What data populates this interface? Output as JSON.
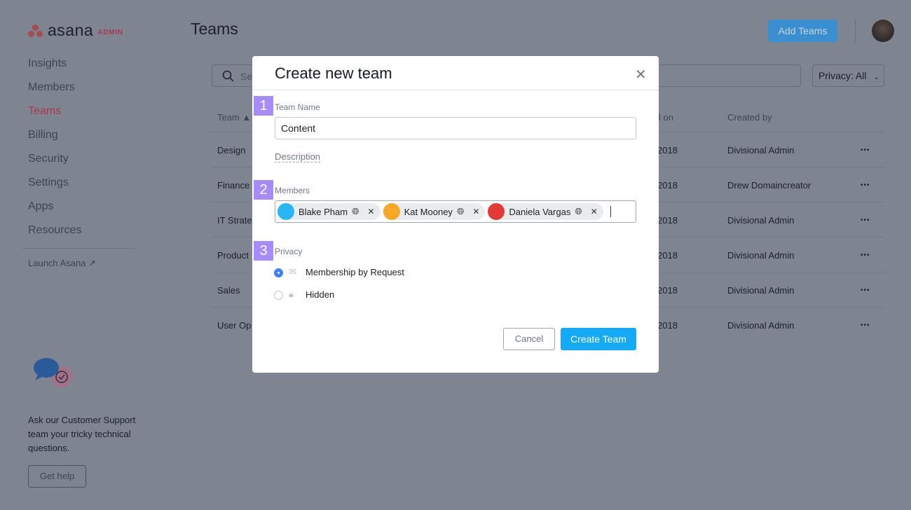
{
  "brand": {
    "name": "asana",
    "badge": "ADMIN"
  },
  "sidebar": {
    "items": [
      {
        "label": "Insights"
      },
      {
        "label": "Members"
      },
      {
        "label": "Teams",
        "active": true
      },
      {
        "label": "Billing"
      },
      {
        "label": "Security"
      },
      {
        "label": "Settings"
      },
      {
        "label": "Apps"
      },
      {
        "label": "Resources"
      }
    ],
    "launch": "Launch Asana ↗",
    "support_text": "Ask our Customer Support team your tricky technical questions.",
    "get_help": "Get help"
  },
  "header": {
    "title": "Teams",
    "add_button": "Add Teams"
  },
  "filters": {
    "search_placeholder": "Se",
    "privacy": "Privacy: All"
  },
  "table": {
    "headers": {
      "team": "Team ▲",
      "created_on": "l on",
      "created_by": "Created by"
    },
    "rows": [
      {
        "team": "Design",
        "date": "2018",
        "by": "Divisional Admin"
      },
      {
        "team": "Finance",
        "date": " 2018",
        "by": "Drew Domaincreator"
      },
      {
        "team": "IT Strate",
        "date": "2018",
        "by": "Divisional Admin"
      },
      {
        "team": "Product",
        "date": "2018",
        "by": "Divisional Admin"
      },
      {
        "team": "Sales",
        "date": "2018",
        "by": "Divisional Admin"
      },
      {
        "team": "User Op",
        "date": "2018",
        "by": "Divisional Admin"
      }
    ],
    "more": "•••"
  },
  "modal": {
    "title": "Create new team",
    "close": "✕",
    "steps": [
      "1",
      "2",
      "3"
    ],
    "team_name_label": "Team Name",
    "team_name_value": "Content",
    "description_link": "Description",
    "members_label": "Members",
    "members": [
      {
        "name": "Blake Pham",
        "color": "#29b6f6"
      },
      {
        "name": "Kat Mooney",
        "color": "#f9a825"
      },
      {
        "name": "Daniela Vargas",
        "color": "#e53935"
      }
    ],
    "privacy_label": "Privacy",
    "privacy_options": [
      {
        "label": "Membership by Request",
        "icon": "envelope-icon",
        "selected": true
      },
      {
        "label": "Hidden",
        "icon": "lock-icon",
        "selected": false
      }
    ],
    "cancel": "Cancel",
    "create": "Create Team"
  },
  "colors": {
    "accent": "#14aaf5",
    "brand": "#f06a6a",
    "step_badge": "#a78bfa"
  }
}
